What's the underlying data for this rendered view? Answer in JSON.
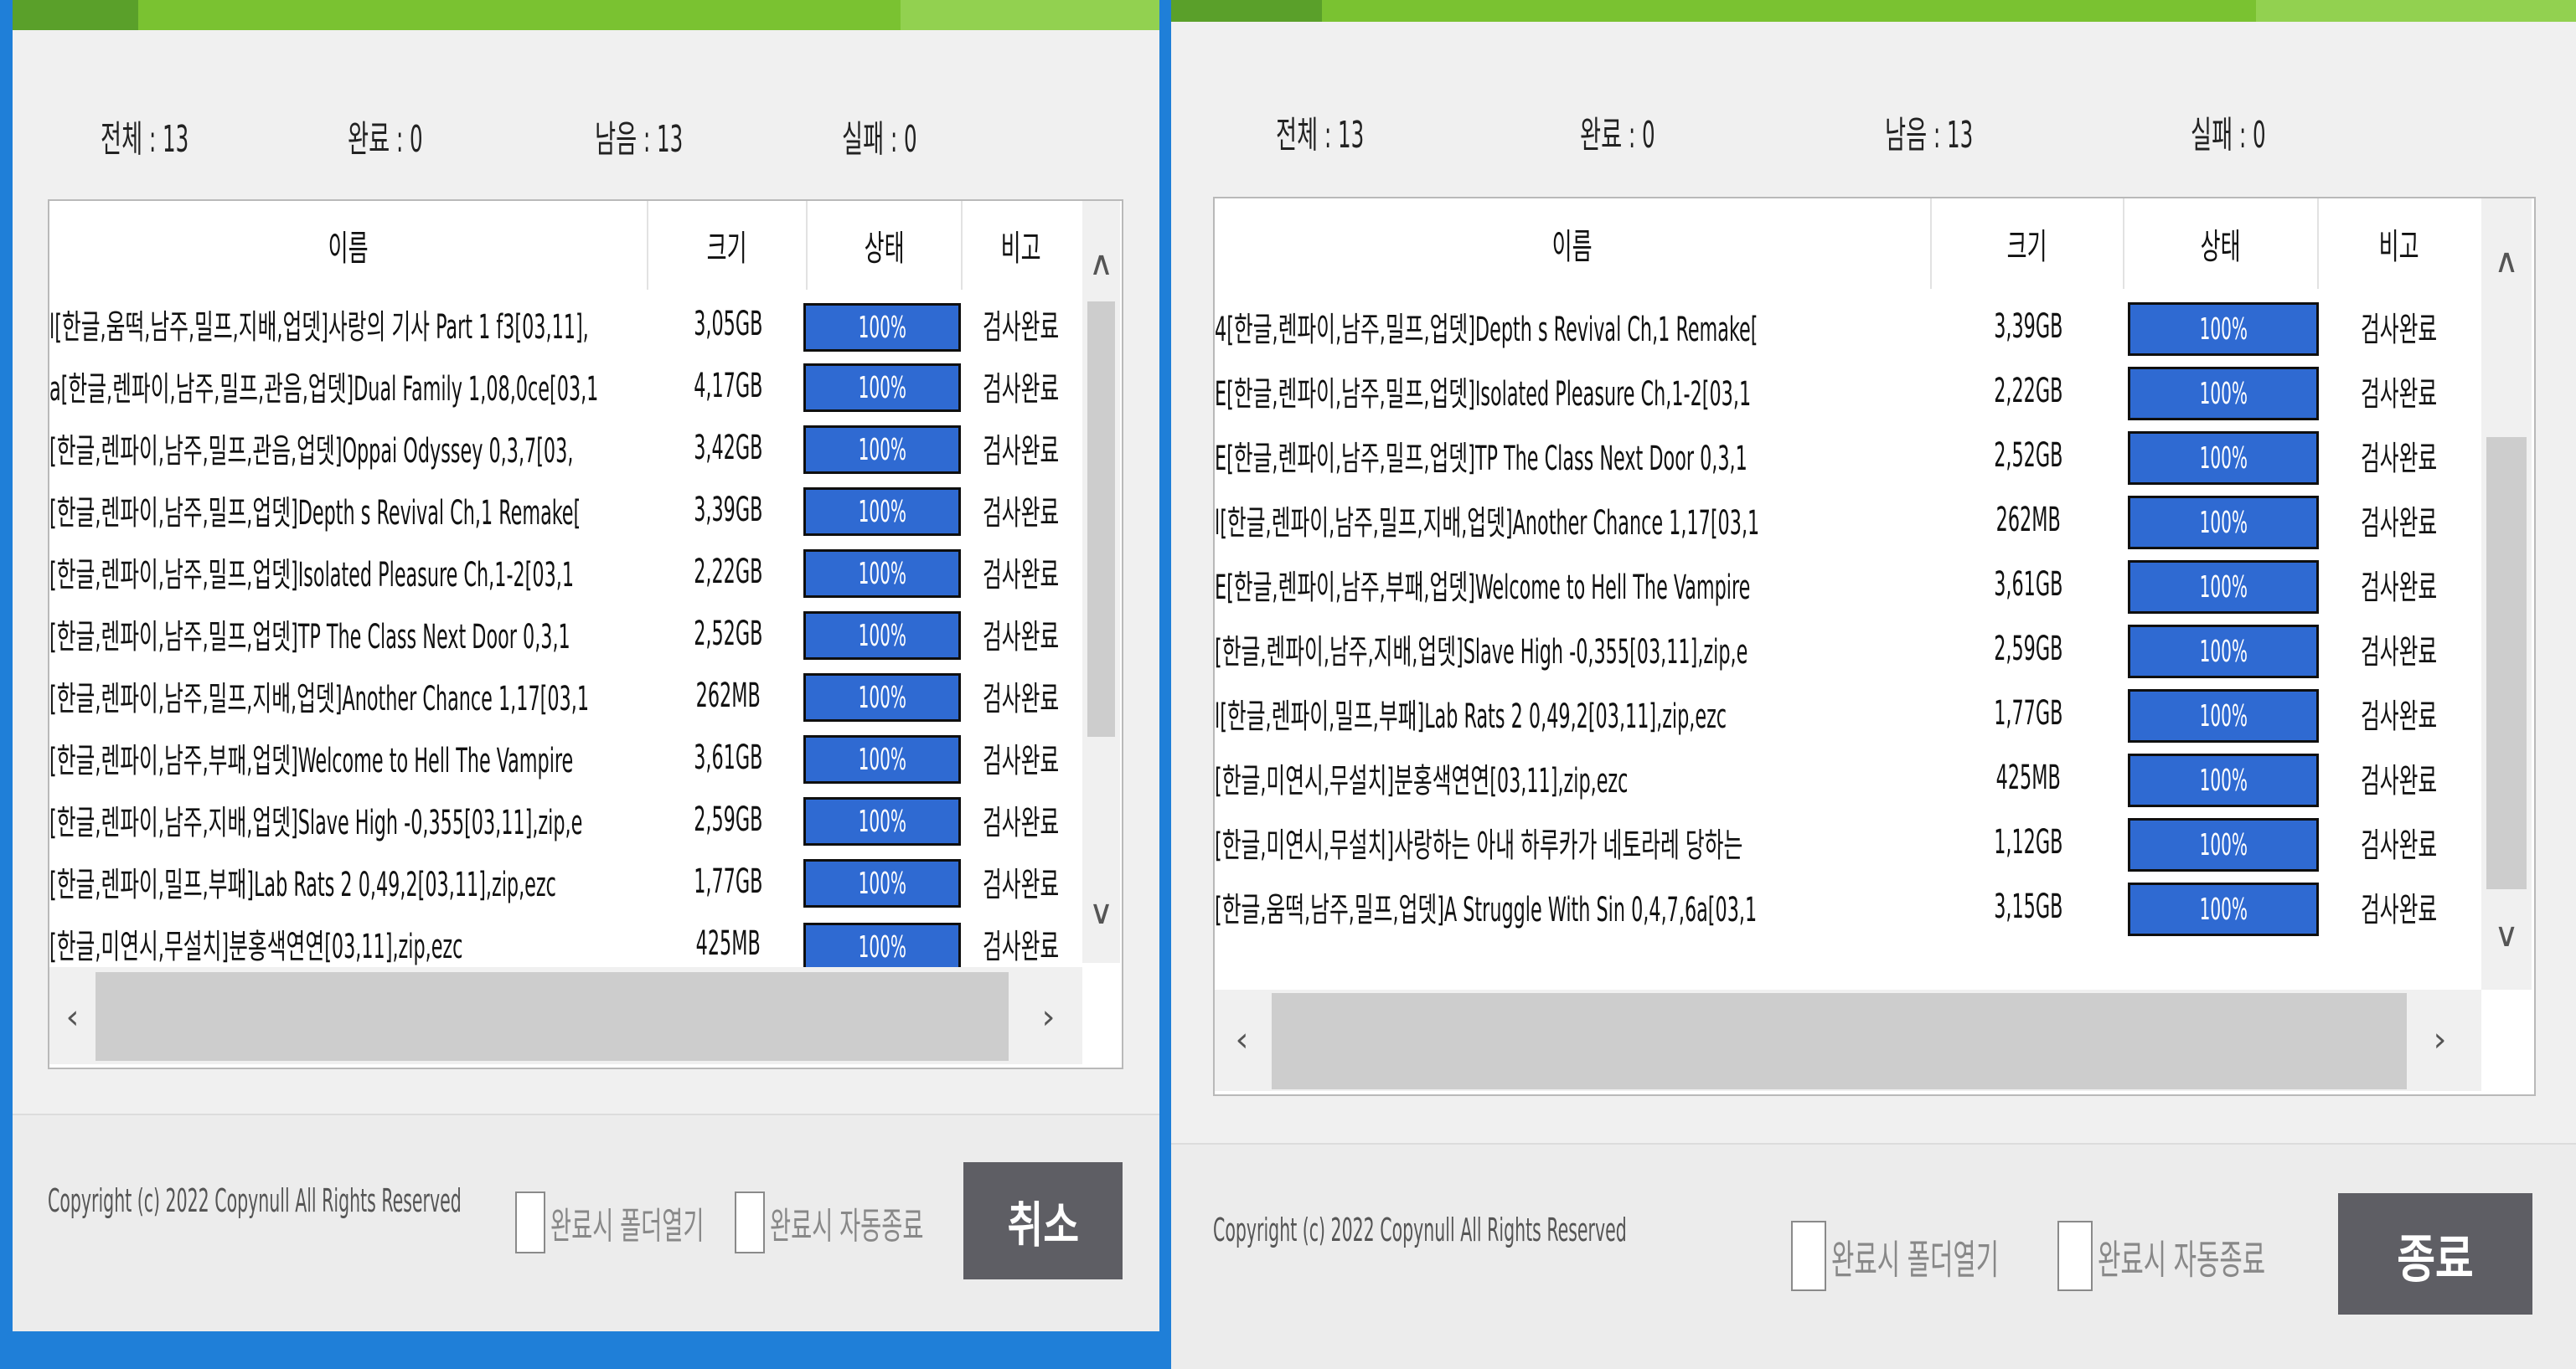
{
  "theme": {
    "accent_green": "#7ac231",
    "progress_blue": "#2f6ad2",
    "desktop_blue": "#1f7fd8",
    "button_gray": "#5e5e64"
  },
  "icons": {
    "up": "caret-up-icon",
    "down": "caret-down-icon",
    "left": "chevron-left-icon",
    "right": "chevron-right-icon"
  },
  "left": {
    "stats": {
      "total": "전체 : 13",
      "done": "완료 : 0",
      "remaining": "남음 : 13",
      "failed": "실패 : 0"
    },
    "headers": {
      "name": "이름",
      "size": "크기",
      "status": "상태",
      "note": "비고"
    },
    "rows": [
      {
        "name": "l[한글,움떡,남주,밀프,지배,업뎃]사랑의 기사 Part 1 f3[03,11],",
        "size": "3,05GB",
        "progress": "100%",
        "note": "검사완료"
      },
      {
        "name": "a[한글,렌파이,남주,밀프,관음,업뎃]Dual Family 1,08,0ce[03,1",
        "size": "4,17GB",
        "progress": "100%",
        "note": "검사완료"
      },
      {
        "name": "[한글,렌파이,남주,밀프,관음,업뎃]Oppai Odyssey 0,3,7[03,",
        "size": "3,42GB",
        "progress": "100%",
        "note": "검사완료"
      },
      {
        "name": "[한글,렌파이,남주,밀프,업뎃]Depth s Revival Ch,1 Remake[",
        "size": "3,39GB",
        "progress": "100%",
        "note": "검사완료"
      },
      {
        "name": "[한글,렌파이,남주,밀프,업뎃]Isolated Pleasure Ch,1-2[03,1",
        "size": "2,22GB",
        "progress": "100%",
        "note": "검사완료"
      },
      {
        "name": "[한글,렌파이,남주,밀프,업뎃]TP The Class Next Door 0,3,1",
        "size": "2,52GB",
        "progress": "100%",
        "note": "검사완료"
      },
      {
        "name": "[한글,렌파이,남주,밀프,지배,업뎃]Another Chance 1,17[03,1",
        "size": "262MB",
        "progress": "100%",
        "note": "검사완료"
      },
      {
        "name": "[한글,렌파이,남주,부패,업뎃]Welcome to Hell The Vampire",
        "size": "3,61GB",
        "progress": "100%",
        "note": "검사완료"
      },
      {
        "name": "[한글,렌파이,남주,지배,업뎃]Slave High -0,355[03,11],zip,e",
        "size": "2,59GB",
        "progress": "100%",
        "note": "검사완료"
      },
      {
        "name": "[한글,렌파이,밀프,부패]Lab Rats 2 0,49,2[03,11],zip,ezc",
        "size": "1,77GB",
        "progress": "100%",
        "note": "검사완료"
      },
      {
        "name": "[한글,미연시,무설치]분홍색연연[03,11],zip,ezc",
        "size": "425MB",
        "progress": "100%",
        "note": "검사완료"
      }
    ],
    "copyright": "Copyright (c) 2022 Copynull All Rights Reserved",
    "open_folder_label": "완료시 폴더열기",
    "auto_exit_label": "완료시 자동종료",
    "button_label": "취소"
  },
  "right": {
    "stats": {
      "total": "전체 : 13",
      "done": "완료 : 0",
      "remaining": "남음 : 13",
      "failed": "실패 : 0"
    },
    "headers": {
      "name": "이름",
      "size": "크기",
      "status": "상태",
      "note": "비고"
    },
    "rows": [
      {
        "name": "4[한글,렌파이,남주,밀프,업뎃]Depth s Revival Ch,1 Remake[",
        "size": "3,39GB",
        "progress": "100%",
        "note": "검사완료"
      },
      {
        "name": "E[한글,렌파이,남주,밀프,업뎃]Isolated Pleasure Ch,1-2[03,1",
        "size": "2,22GB",
        "progress": "100%",
        "note": "검사완료"
      },
      {
        "name": "E[한글,렌파이,남주,밀프,업뎃]TP The Class Next Door 0,3,1",
        "size": "2,52GB",
        "progress": "100%",
        "note": "검사완료"
      },
      {
        "name": "l[한글,렌파이,남주,밀프,지배,업뎃]Another Chance 1,17[03,1",
        "size": "262MB",
        "progress": "100%",
        "note": "검사완료"
      },
      {
        "name": "E[한글,렌파이,남주,부패,업뎃]Welcome to Hell The Vampire",
        "size": "3,61GB",
        "progress": "100%",
        "note": "검사완료"
      },
      {
        "name": "[한글,렌파이,남주,지배,업뎃]Slave High -0,355[03,11],zip,e",
        "size": "2,59GB",
        "progress": "100%",
        "note": "검사완료"
      },
      {
        "name": "l[한글,렌파이,밀프,부패]Lab Rats 2 0,49,2[03,11],zip,ezc",
        "size": "1,77GB",
        "progress": "100%",
        "note": "검사완료"
      },
      {
        "name": "[한글,미연시,무설치]분홍색연연[03,11],zip,ezc",
        "size": "425MB",
        "progress": "100%",
        "note": "검사완료"
      },
      {
        "name": "[한글,미연시,무설치]사랑하는 아내 하루카가 네토라레 당하는",
        "size": "1,12GB",
        "progress": "100%",
        "note": "검사완료"
      },
      {
        "name": "[한글,움떡,남주,밀프,업뎃]A Struggle With Sin 0,4,7,6a[03,1",
        "size": "3,15GB",
        "progress": "100%",
        "note": "검사완료"
      }
    ],
    "copyright": "Copyright (c) 2022 Copynull All Rights Reserved",
    "open_folder_label": "완료시 폴더열기",
    "auto_exit_label": "완료시 자동종료",
    "button_label": "종료"
  }
}
